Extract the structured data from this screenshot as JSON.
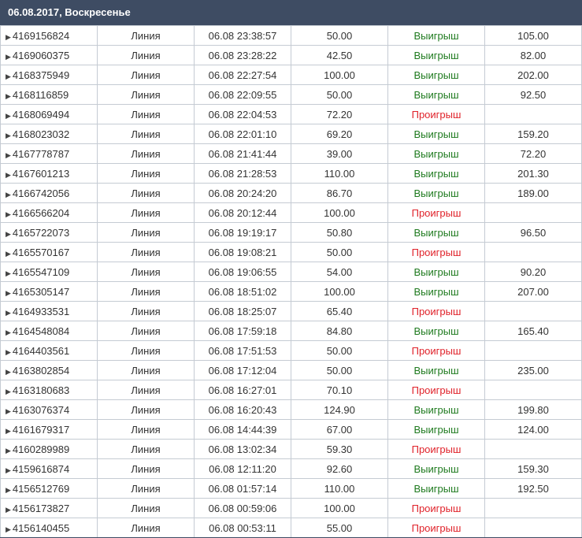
{
  "header": {
    "title": "06.08.2017, Воскресенье"
  },
  "colors": {
    "win": "#1e7a1e",
    "lose": "#e0222a",
    "header": "#3e4c63"
  },
  "rows": [
    {
      "id": "4169156824",
      "type": "Линия",
      "time": "06.08 23:38:57",
      "stake": "50.00",
      "result": "Выигрыш",
      "win": true,
      "payout": "105.00"
    },
    {
      "id": "4169060375",
      "type": "Линия",
      "time": "06.08 23:28:22",
      "stake": "42.50",
      "result": "Выигрыш",
      "win": true,
      "payout": "82.00"
    },
    {
      "id": "4168375949",
      "type": "Линия",
      "time": "06.08 22:27:54",
      "stake": "100.00",
      "result": "Выигрыш",
      "win": true,
      "payout": "202.00"
    },
    {
      "id": "4168116859",
      "type": "Линия",
      "time": "06.08 22:09:55",
      "stake": "50.00",
      "result": "Выигрыш",
      "win": true,
      "payout": "92.50"
    },
    {
      "id": "4168069494",
      "type": "Линия",
      "time": "06.08 22:04:53",
      "stake": "72.20",
      "result": "Проигрыш",
      "win": false,
      "payout": ""
    },
    {
      "id": "4168023032",
      "type": "Линия",
      "time": "06.08 22:01:10",
      "stake": "69.20",
      "result": "Выигрыш",
      "win": true,
      "payout": "159.20"
    },
    {
      "id": "4167778787",
      "type": "Линия",
      "time": "06.08 21:41:44",
      "stake": "39.00",
      "result": "Выигрыш",
      "win": true,
      "payout": "72.20"
    },
    {
      "id": "4167601213",
      "type": "Линия",
      "time": "06.08 21:28:53",
      "stake": "110.00",
      "result": "Выигрыш",
      "win": true,
      "payout": "201.30"
    },
    {
      "id": "4166742056",
      "type": "Линия",
      "time": "06.08 20:24:20",
      "stake": "86.70",
      "result": "Выигрыш",
      "win": true,
      "payout": "189.00"
    },
    {
      "id": "4166566204",
      "type": "Линия",
      "time": "06.08 20:12:44",
      "stake": "100.00",
      "result": "Проигрыш",
      "win": false,
      "payout": ""
    },
    {
      "id": "4165722073",
      "type": "Линия",
      "time": "06.08 19:19:17",
      "stake": "50.80",
      "result": "Выигрыш",
      "win": true,
      "payout": "96.50"
    },
    {
      "id": "4165570167",
      "type": "Линия",
      "time": "06.08 19:08:21",
      "stake": "50.00",
      "result": "Проигрыш",
      "win": false,
      "payout": ""
    },
    {
      "id": "4165547109",
      "type": "Линия",
      "time": "06.08 19:06:55",
      "stake": "54.00",
      "result": "Выигрыш",
      "win": true,
      "payout": "90.20"
    },
    {
      "id": "4165305147",
      "type": "Линия",
      "time": "06.08 18:51:02",
      "stake": "100.00",
      "result": "Выигрыш",
      "win": true,
      "payout": "207.00"
    },
    {
      "id": "4164933531",
      "type": "Линия",
      "time": "06.08 18:25:07",
      "stake": "65.40",
      "result": "Проигрыш",
      "win": false,
      "payout": ""
    },
    {
      "id": "4164548084",
      "type": "Линия",
      "time": "06.08 17:59:18",
      "stake": "84.80",
      "result": "Выигрыш",
      "win": true,
      "payout": "165.40"
    },
    {
      "id": "4164403561",
      "type": "Линия",
      "time": "06.08 17:51:53",
      "stake": "50.00",
      "result": "Проигрыш",
      "win": false,
      "payout": ""
    },
    {
      "id": "4163802854",
      "type": "Линия",
      "time": "06.08 17:12:04",
      "stake": "50.00",
      "result": "Выигрыш",
      "win": true,
      "payout": "235.00"
    },
    {
      "id": "4163180683",
      "type": "Линия",
      "time": "06.08 16:27:01",
      "stake": "70.10",
      "result": "Проигрыш",
      "win": false,
      "payout": ""
    },
    {
      "id": "4163076374",
      "type": "Линия",
      "time": "06.08 16:20:43",
      "stake": "124.90",
      "result": "Выигрыш",
      "win": true,
      "payout": "199.80"
    },
    {
      "id": "4161679317",
      "type": "Линия",
      "time": "06.08 14:44:39",
      "stake": "67.00",
      "result": "Выигрыш",
      "win": true,
      "payout": "124.00"
    },
    {
      "id": "4160289989",
      "type": "Линия",
      "time": "06.08 13:02:34",
      "stake": "59.30",
      "result": "Проигрыш",
      "win": false,
      "payout": ""
    },
    {
      "id": "4159616874",
      "type": "Линия",
      "time": "06.08 12:11:20",
      "stake": "92.60",
      "result": "Выигрыш",
      "win": true,
      "payout": "159.30"
    },
    {
      "id": "4156512769",
      "type": "Линия",
      "time": "06.08 01:57:14",
      "stake": "110.00",
      "result": "Выигрыш",
      "win": true,
      "payout": "192.50"
    },
    {
      "id": "4156173827",
      "type": "Линия",
      "time": "06.08 00:59:06",
      "stake": "100.00",
      "result": "Проигрыш",
      "win": false,
      "payout": ""
    },
    {
      "id": "4156140455",
      "type": "Линия",
      "time": "06.08 00:53:11",
      "stake": "55.00",
      "result": "Проигрыш",
      "win": false,
      "payout": ""
    }
  ]
}
